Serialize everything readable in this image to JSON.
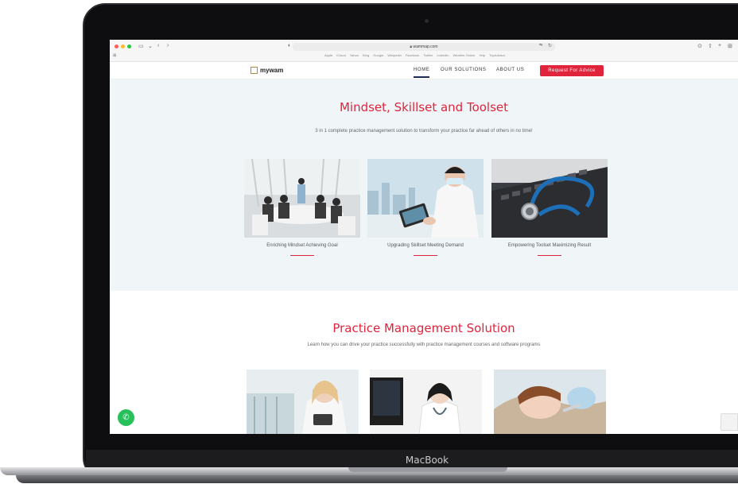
{
  "laptop": {
    "brand": "MacBook"
  },
  "browser": {
    "url": "wammap.com",
    "bookmarks": [
      "Apple",
      "iCloud",
      "Yahoo",
      "Bing",
      "Google",
      "Wikipedia",
      "Facebook",
      "Twitter",
      "LinkedIn",
      "Weather Online",
      "Yelp",
      "TripAdvisor"
    ]
  },
  "site": {
    "logo": "mywam",
    "nav": [
      "HOME",
      "OUR SOLUTIONS",
      "ABOUT US"
    ],
    "cta": "Request For Advice"
  },
  "section1": {
    "title": "Mindset, Skillset and Toolset",
    "subtitle": "3 in 1 complete practice management solution to transform your practice far ahead of others in no time!",
    "cards": [
      {
        "caption": "Enriching Mindset Achieving Goal"
      },
      {
        "caption": "Upgrading Skillset Meeting Demand"
      },
      {
        "caption": "Empowering Toolset Maximizing Result"
      }
    ]
  },
  "section2": {
    "title": "Practice Management Solution",
    "subtitle": "Learn how you can drive your practice successfully with practice management courses and software programs"
  },
  "colors": {
    "accent": "#e0243c",
    "navy": "#1f2a55",
    "whatsapp": "#28c05a",
    "hero_bg": "#f0f6f8"
  }
}
